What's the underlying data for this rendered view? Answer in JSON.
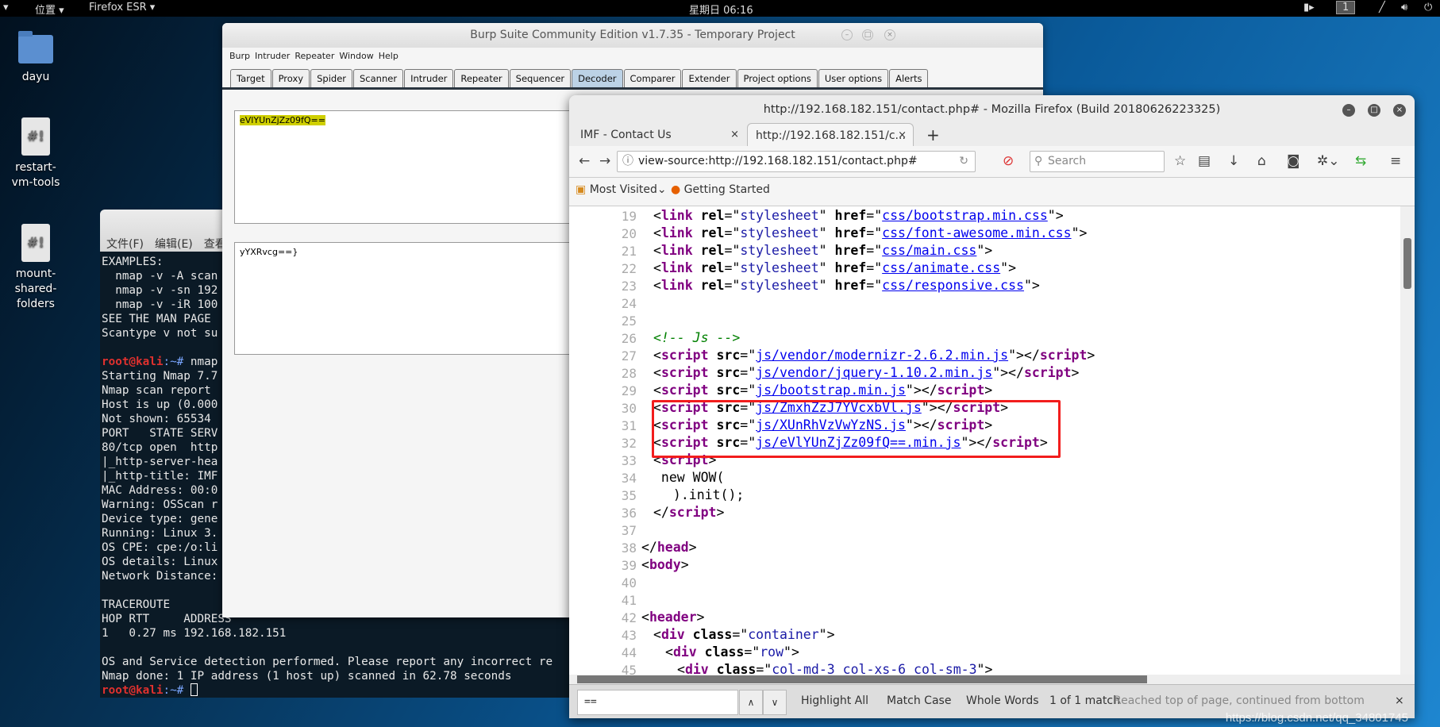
{
  "topbar": {
    "applications_arrow": "▾",
    "places": "位置 ▾",
    "firefox": "Firefox ESR ▾",
    "clock": "星期日 06:16",
    "workspace": "1"
  },
  "desktop": {
    "icons": [
      {
        "label": "dayu",
        "type": "folder"
      },
      {
        "label": "restart-vm-tools",
        "type": "script"
      },
      {
        "label": "mount-shared-folders",
        "type": "script"
      }
    ],
    "script_glyph": "#!"
  },
  "terminal": {
    "menu": [
      "文件(F)",
      "编辑(E)",
      "查看"
    ],
    "lines": [
      "EXAMPLES:",
      "  nmap -v -A scan",
      "  nmap -v -sn 192",
      "  nmap -v -iR 100",
      "SEE THE MAN PAGE",
      "Scantype v not su",
      "",
      "PROMPT nmap",
      "Starting Nmap 7.7",
      "Nmap scan report",
      "Host is up (0.000",
      "Not shown: 65534",
      "PORT   STATE SERV",
      "80/tcp open  http",
      "|_http-server-hea",
      "|_http-title: IMF",
      "MAC Address: 00:0",
      "Warning: OSScan r",
      "Device type: gene",
      "Running: Linux 3.",
      "OS CPE: cpe:/o:li",
      "OS details: Linux",
      "Network Distance:",
      "",
      "TRACEROUTE",
      "HOP RTT     ADDRESS",
      "1   0.27 ms 192.168.182.151",
      "",
      "OS and Service detection performed. Please report any incorrect re",
      "Nmap done: 1 IP address (1 host up) scanned in 62.78 seconds",
      "PROMPT "
    ],
    "prompt_user": "root@kali",
    "prompt_path": ":~#"
  },
  "burp": {
    "title": "Burp Suite Community Edition v1.7.35 - Temporary Project",
    "menu": [
      "Burp",
      "Intruder",
      "Repeater",
      "Window",
      "Help"
    ],
    "tabs": [
      "Target",
      "Proxy",
      "Spider",
      "Scanner",
      "Intruder",
      "Repeater",
      "Sequencer",
      "Decoder",
      "Comparer",
      "Extender",
      "Project options",
      "User options",
      "Alerts"
    ],
    "active_tab": "Decoder",
    "decoder_input": "eVlYUnZjZz09fQ==",
    "decoder_output": "yYXRvcg==}"
  },
  "firefox": {
    "title": "http://192.168.182.151/contact.php# - Mozilla Firefox (Build 20180626223325)",
    "tabs": [
      {
        "label": "IMF - Contact Us",
        "active": false
      },
      {
        "label": "http://192.168.182.151/c...",
        "active": true
      }
    ],
    "url": "view-source:http://192.168.182.151/contact.php#",
    "search_placeholder": "Search",
    "bookmarks": [
      "Most Visited",
      "Getting Started"
    ],
    "source": [
      {
        "n": 19,
        "i": 1,
        "s": [
          [
            "p",
            "<"
          ],
          [
            "t",
            "link"
          ],
          [
            "a",
            " rel"
          ],
          [
            "p",
            "=\""
          ],
          [
            "v",
            "stylesheet"
          ],
          [
            "p",
            "\""
          ],
          [
            "a",
            " href"
          ],
          [
            "p",
            "=\""
          ],
          [
            "l",
            "css/bootstrap.min.css"
          ],
          [
            "p",
            "\">"
          ]
        ]
      },
      {
        "n": 20,
        "i": 1,
        "s": [
          [
            "p",
            "<"
          ],
          [
            "t",
            "link"
          ],
          [
            "a",
            " rel"
          ],
          [
            "p",
            "=\""
          ],
          [
            "v",
            "stylesheet"
          ],
          [
            "p",
            "\""
          ],
          [
            "a",
            " href"
          ],
          [
            "p",
            "=\""
          ],
          [
            "l",
            "css/font-awesome.min.css"
          ],
          [
            "p",
            "\">"
          ]
        ]
      },
      {
        "n": 21,
        "i": 1,
        "s": [
          [
            "p",
            "<"
          ],
          [
            "t",
            "link"
          ],
          [
            "a",
            " rel"
          ],
          [
            "p",
            "=\""
          ],
          [
            "v",
            "stylesheet"
          ],
          [
            "p",
            "\""
          ],
          [
            "a",
            " href"
          ],
          [
            "p",
            "=\""
          ],
          [
            "l",
            "css/main.css"
          ],
          [
            "p",
            "\">"
          ]
        ]
      },
      {
        "n": 22,
        "i": 1,
        "s": [
          [
            "p",
            "<"
          ],
          [
            "t",
            "link"
          ],
          [
            "a",
            " rel"
          ],
          [
            "p",
            "=\""
          ],
          [
            "v",
            "stylesheet"
          ],
          [
            "p",
            "\""
          ],
          [
            "a",
            " href"
          ],
          [
            "p",
            "=\""
          ],
          [
            "l",
            "css/animate.css"
          ],
          [
            "p",
            "\">"
          ]
        ]
      },
      {
        "n": 23,
        "i": 1,
        "s": [
          [
            "p",
            "<"
          ],
          [
            "t",
            "link"
          ],
          [
            "a",
            " rel"
          ],
          [
            "p",
            "=\""
          ],
          [
            "v",
            "stylesheet"
          ],
          [
            "p",
            "\""
          ],
          [
            "a",
            " href"
          ],
          [
            "p",
            "=\""
          ],
          [
            "l",
            "css/responsive.css"
          ],
          [
            "p",
            "\">"
          ]
        ]
      },
      {
        "n": 24,
        "i": 0,
        "s": []
      },
      {
        "n": 25,
        "i": 0,
        "s": []
      },
      {
        "n": 26,
        "i": 1,
        "s": [
          [
            "c",
            "<!-- Js -->"
          ]
        ]
      },
      {
        "n": 27,
        "i": 1,
        "s": [
          [
            "p",
            "<"
          ],
          [
            "t",
            "script"
          ],
          [
            "a",
            " src"
          ],
          [
            "p",
            "=\""
          ],
          [
            "l",
            "js/vendor/modernizr-2.6.2.min.js"
          ],
          [
            "p",
            "\"></"
          ],
          [
            "t",
            "script"
          ],
          [
            "p",
            ">"
          ]
        ]
      },
      {
        "n": 28,
        "i": 1,
        "s": [
          [
            "p",
            "<"
          ],
          [
            "t",
            "script"
          ],
          [
            "a",
            " src"
          ],
          [
            "p",
            "=\""
          ],
          [
            "l",
            "js/vendor/jquery-1.10.2.min.js"
          ],
          [
            "p",
            "\"></"
          ],
          [
            "t",
            "script"
          ],
          [
            "p",
            ">"
          ]
        ]
      },
      {
        "n": 29,
        "i": 1,
        "s": [
          [
            "p",
            "<"
          ],
          [
            "t",
            "script"
          ],
          [
            "a",
            " src"
          ],
          [
            "p",
            "=\""
          ],
          [
            "l",
            "js/bootstrap.min.js"
          ],
          [
            "p",
            "\"></"
          ],
          [
            "t",
            "script"
          ],
          [
            "p",
            ">"
          ]
        ]
      },
      {
        "n": 30,
        "i": 1,
        "s": [
          [
            "p",
            "<"
          ],
          [
            "t",
            "script"
          ],
          [
            "a",
            " src"
          ],
          [
            "p",
            "=\""
          ],
          [
            "l",
            "js/ZmxhZzJ7YVcxbVl.js"
          ],
          [
            "p",
            "\"></"
          ],
          [
            "t",
            "script"
          ],
          [
            "p",
            ">"
          ]
        ]
      },
      {
        "n": 31,
        "i": 1,
        "s": [
          [
            "p",
            "<"
          ],
          [
            "t",
            "script"
          ],
          [
            "a",
            " src"
          ],
          [
            "p",
            "=\""
          ],
          [
            "l",
            "js/XUnRhVzVwYzNS.js"
          ],
          [
            "p",
            "\"></"
          ],
          [
            "t",
            "script"
          ],
          [
            "p",
            ">"
          ]
        ]
      },
      {
        "n": 32,
        "i": 1,
        "s": [
          [
            "p",
            "<"
          ],
          [
            "t",
            "script"
          ],
          [
            "a",
            " src"
          ],
          [
            "p",
            "=\""
          ],
          [
            "l",
            "js/eVlYUnZjZz09fQ==.min.js"
          ],
          [
            "p",
            "\"></"
          ],
          [
            "t",
            "script"
          ],
          [
            "p",
            ">"
          ]
        ]
      },
      {
        "n": 33,
        "i": 1,
        "s": [
          [
            "p",
            "<"
          ],
          [
            "t",
            "script"
          ],
          [
            "p",
            ">"
          ]
        ]
      },
      {
        "n": 34,
        "i": 1,
        "s": [
          [
            "p",
            " new WOW("
          ]
        ]
      },
      {
        "n": 35,
        "i": 2,
        "s": [
          [
            "p",
            " ).init();"
          ]
        ]
      },
      {
        "n": 36,
        "i": 1,
        "s": [
          [
            "p",
            "</"
          ],
          [
            "t",
            "script"
          ],
          [
            "p",
            ">"
          ]
        ]
      },
      {
        "n": 37,
        "i": 0,
        "s": []
      },
      {
        "n": 38,
        "i": 0,
        "s": [
          [
            "p",
            "</"
          ],
          [
            "t",
            "head"
          ],
          [
            "p",
            ">"
          ]
        ]
      },
      {
        "n": 39,
        "i": 0,
        "s": [
          [
            "p",
            "<"
          ],
          [
            "t",
            "body"
          ],
          [
            "p",
            ">"
          ]
        ]
      },
      {
        "n": 40,
        "i": 0,
        "s": []
      },
      {
        "n": 41,
        "i": 0,
        "s": []
      },
      {
        "n": 42,
        "i": 0,
        "s": [
          [
            "p",
            "<"
          ],
          [
            "t",
            "header"
          ],
          [
            "p",
            ">"
          ]
        ]
      },
      {
        "n": 43,
        "i": 1,
        "s": [
          [
            "p",
            "<"
          ],
          [
            "t",
            "div"
          ],
          [
            "a",
            " class"
          ],
          [
            "p",
            "=\""
          ],
          [
            "v",
            "container"
          ],
          [
            "p",
            "\">"
          ]
        ]
      },
      {
        "n": 44,
        "i": 2,
        "s": [
          [
            "p",
            "<"
          ],
          [
            "t",
            "div"
          ],
          [
            "a",
            " class"
          ],
          [
            "p",
            "=\""
          ],
          [
            "v",
            "row"
          ],
          [
            "p",
            "\">"
          ]
        ]
      },
      {
        "n": 45,
        "i": 3,
        "s": [
          [
            "p",
            "<"
          ],
          [
            "t",
            "div"
          ],
          [
            "a",
            " class"
          ],
          [
            "p",
            "=\""
          ],
          [
            "v",
            "col-md-3 col-xs-6 col-sm-3"
          ],
          [
            "p",
            "\">"
          ]
        ]
      }
    ],
    "find": {
      "value": "==",
      "highlight_all": "Highlight All",
      "match_case": "Match Case",
      "whole_words": "Whole Words",
      "count": "1 of 1 match",
      "status": "Reached top of page, continued from bottom"
    }
  },
  "watermark": "https://blog.csdn.net/qq_34801745",
  "colors": {
    "highlight_box": "#f21d1d",
    "decoder_highlight": "#cfcf00",
    "prompt": "#e0312e"
  }
}
